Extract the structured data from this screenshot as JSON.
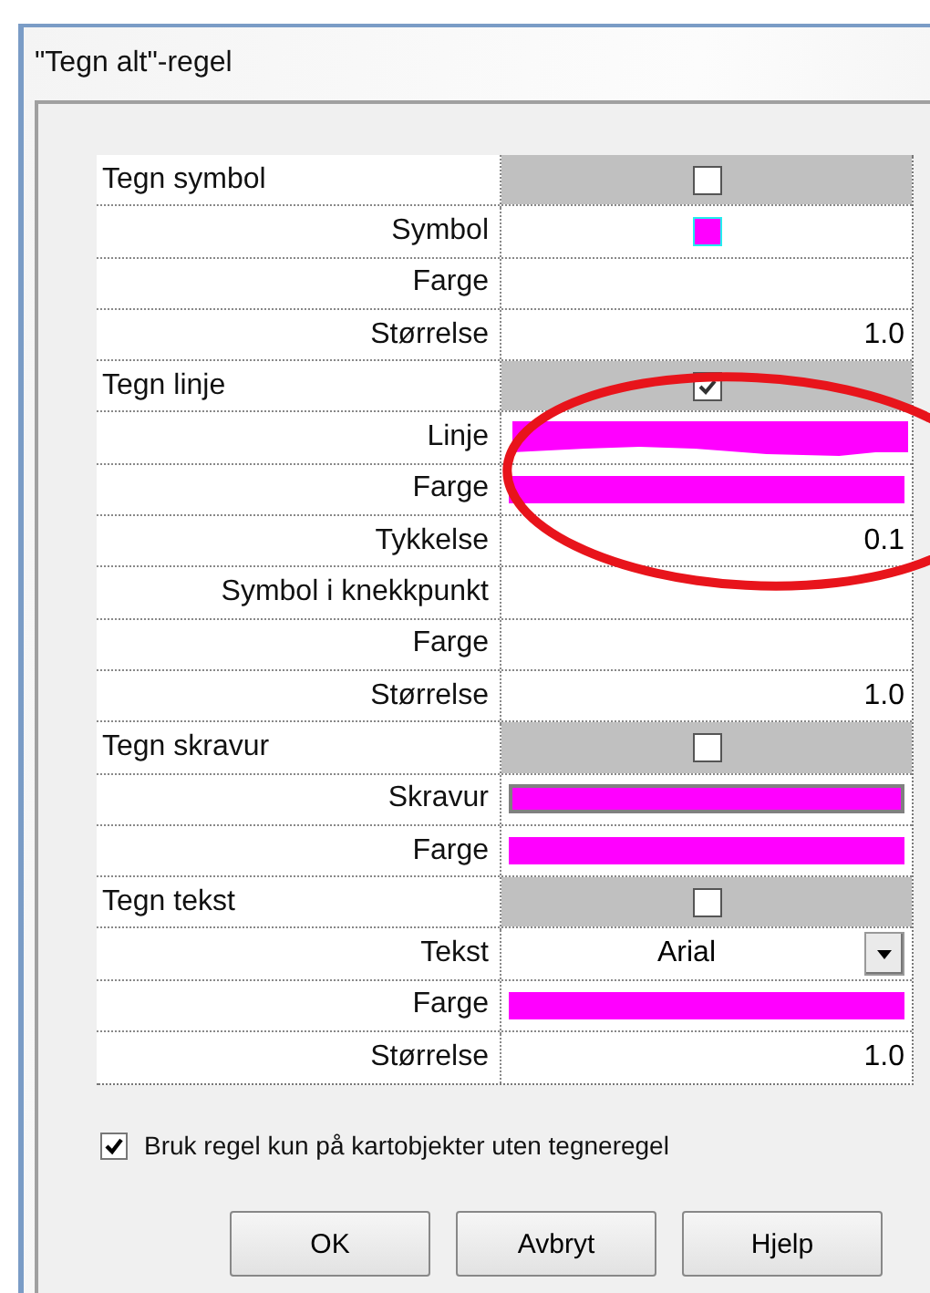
{
  "window": {
    "title": "\"Tegn alt\"-regel"
  },
  "rows": [
    {
      "kind": "group",
      "label": "Tegn symbol",
      "checked": false
    },
    {
      "kind": "swatch",
      "label": "Symbol"
    },
    {
      "kind": "empty",
      "label": "Farge"
    },
    {
      "kind": "number",
      "label": "Størrelse",
      "value": "1.0"
    },
    {
      "kind": "group",
      "label": "Tegn linje",
      "checked": true
    },
    {
      "kind": "line",
      "label": "Linje"
    },
    {
      "kind": "bar",
      "label": "Farge"
    },
    {
      "kind": "number",
      "label": "Tykkelse",
      "value": "0.1"
    },
    {
      "kind": "empty",
      "label": "Symbol i knekkpunkt"
    },
    {
      "kind": "empty",
      "label": "Farge"
    },
    {
      "kind": "number",
      "label": "Størrelse",
      "value": "1.0"
    },
    {
      "kind": "group",
      "label": "Tegn skravur",
      "checked": false
    },
    {
      "kind": "hatch",
      "label": "Skravur"
    },
    {
      "kind": "bar",
      "label": "Farge"
    },
    {
      "kind": "group",
      "label": "Tegn tekst",
      "checked": false
    },
    {
      "kind": "dropdown",
      "label": "Tekst",
      "value": "Arial"
    },
    {
      "kind": "bar",
      "label": "Farge"
    },
    {
      "kind": "number",
      "label": "Størrelse",
      "value": "1.0"
    }
  ],
  "option": {
    "label": "Bruk regel kun på kartobjekter uten tegneregel",
    "checked": true
  },
  "buttons": [
    "OK",
    "Avbryt",
    "Hjelp"
  ]
}
